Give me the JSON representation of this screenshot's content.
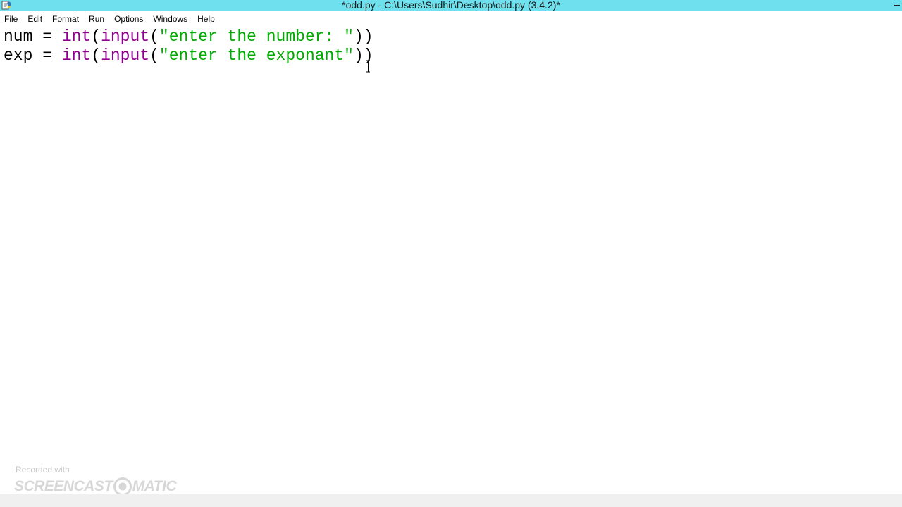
{
  "window": {
    "title": "*odd.py - C:\\Users\\Sudhir\\Desktop\\odd.py (3.4.2)*",
    "app_icon": "python-idle-icon",
    "titlebar_color": "#6fe0ee"
  },
  "menu": {
    "items": [
      {
        "label": "File"
      },
      {
        "label": "Edit"
      },
      {
        "label": "Format"
      },
      {
        "label": "Run"
      },
      {
        "label": "Options"
      },
      {
        "label": "Windows"
      },
      {
        "label": "Help"
      }
    ]
  },
  "editor": {
    "lines": [
      {
        "var": "num",
        "op": " = ",
        "fn1": "int",
        "p1": "(",
        "fn2": "input",
        "p2": "(",
        "str": "\"enter the number: \"",
        "close": "))"
      },
      {
        "var": "exp",
        "op": " = ",
        "fn1": "int",
        "p1": "(",
        "fn2": "input",
        "p2": "(",
        "str": "\"enter the exponant\"",
        "close": "))"
      }
    ],
    "colors": {
      "builtin": "#900090",
      "string": "#00aa00",
      "plain": "#000000"
    },
    "cursor_icon": "ibeam-cursor-icon"
  },
  "watermark": {
    "recorded_with": "Recorded with",
    "brand_left": "SCREENCAST",
    "brand_right": "MATIC"
  }
}
